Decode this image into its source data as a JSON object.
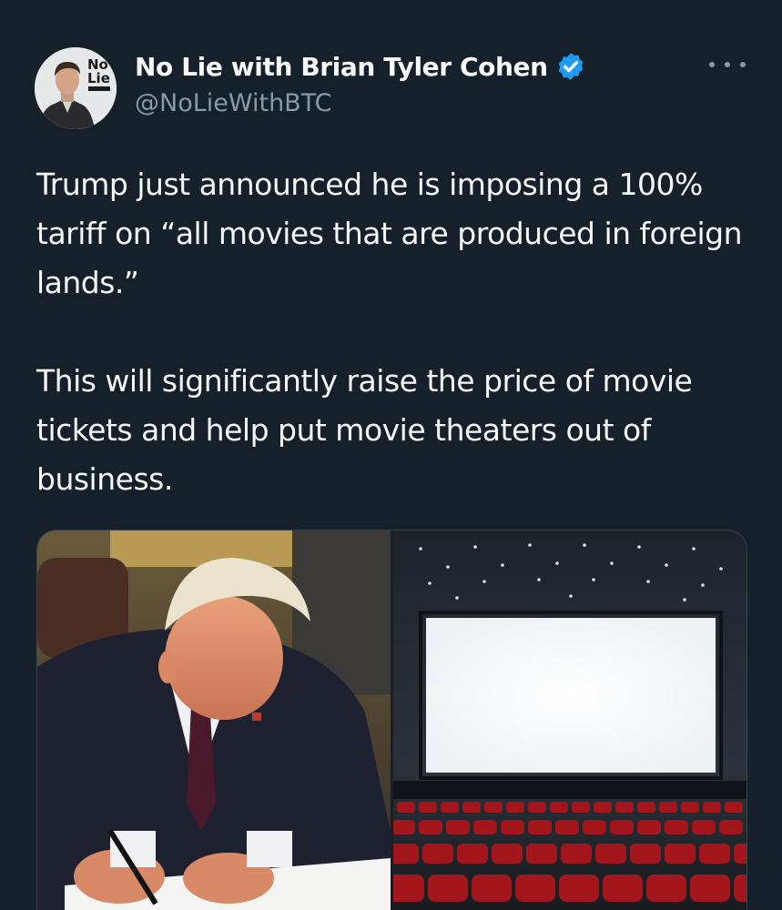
{
  "author": {
    "display_name": "No Lie with Brian Tyler Cohen",
    "handle": "@NoLieWithBTC",
    "verified": true,
    "avatar_logo_text": [
      "No",
      "Lie"
    ]
  },
  "tweet": {
    "paragraphs": [
      "Trump just announced he is imposing a 100% tariff on “all movies that are produced in foreign lands.”",
      "This will significantly raise the price of movie tickets and help put movie theaters out of business."
    ]
  },
  "media": [
    {
      "icon": "photo-man-signing-document"
    },
    {
      "icon": "photo-empty-movie-theater"
    }
  ],
  "colors": {
    "background": "#15202b",
    "text": "#f7f9f9",
    "secondary_text": "#8b98a5",
    "verified": "#1d9bf0",
    "theater_seats": "#a3161c"
  }
}
